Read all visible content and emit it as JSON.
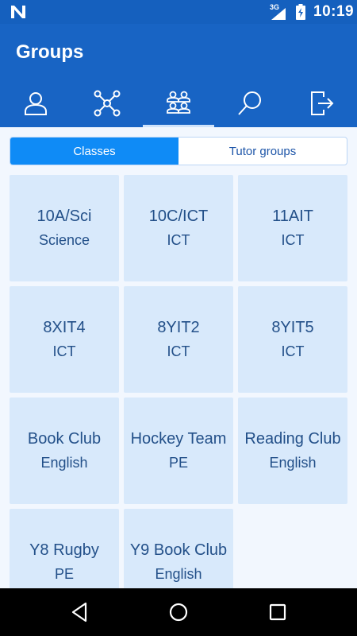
{
  "status_bar": {
    "network": "3G",
    "time": "10:19"
  },
  "app_bar": {
    "title": "Groups"
  },
  "tabs": [
    {
      "icon": "person-icon",
      "active": false
    },
    {
      "icon": "network-icon",
      "active": false
    },
    {
      "icon": "groups-icon",
      "active": true
    },
    {
      "icon": "search-icon",
      "active": false
    },
    {
      "icon": "logout-icon",
      "active": false
    }
  ],
  "segmented": {
    "classes_label": "Classes",
    "tutor_groups_label": "Tutor groups",
    "selected": "Classes"
  },
  "groups": [
    {
      "name": "10A/Sci",
      "subject": "Science"
    },
    {
      "name": "10C/ICT",
      "subject": "ICT"
    },
    {
      "name": "11AIT",
      "subject": "ICT"
    },
    {
      "name": "8XIT4",
      "subject": "ICT"
    },
    {
      "name": "8YIT2",
      "subject": "ICT"
    },
    {
      "name": "8YIT5",
      "subject": "ICT"
    },
    {
      "name": "Book Club",
      "subject": "English"
    },
    {
      "name": "Hockey Team",
      "subject": "PE"
    },
    {
      "name": "Reading Club",
      "subject": "English"
    },
    {
      "name": "Y8 Rugby",
      "subject": "PE"
    },
    {
      "name": "Y9 Book Club",
      "subject": "English"
    }
  ],
  "colors": {
    "primary": "#1864c4",
    "status_bar": "#1560be",
    "accent": "#0f8bf6",
    "card": "#d8e9fb",
    "card_text": "#235089"
  }
}
